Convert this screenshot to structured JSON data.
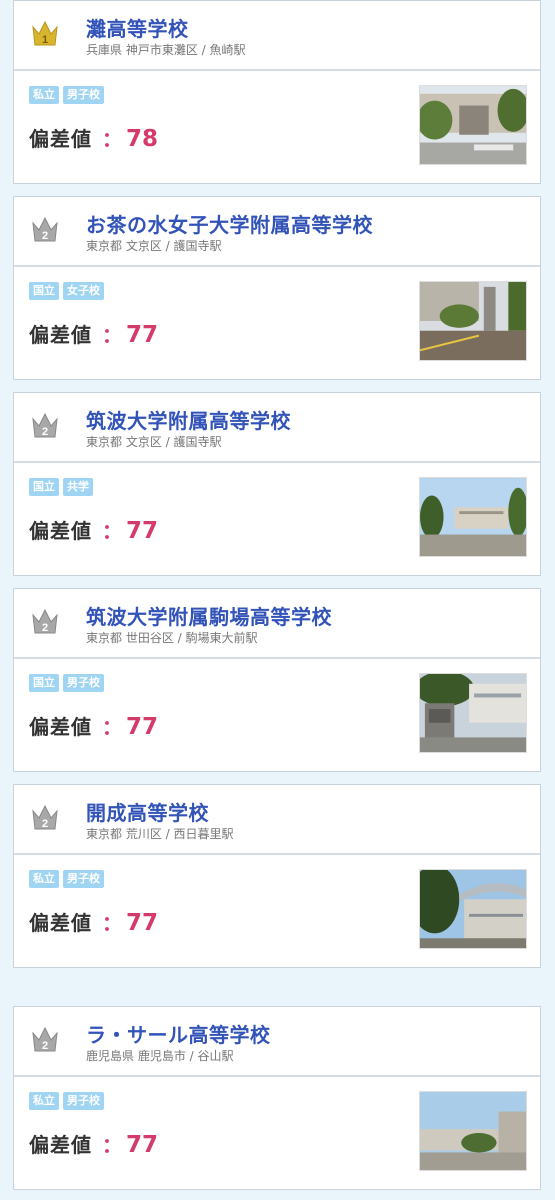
{
  "score_label": "偏差値",
  "score_colon": "：",
  "schools": [
    {
      "rank": "1",
      "name": "灘高等学校",
      "address": "兵庫県 神戸市東灘区 / 魚崎駅",
      "tags": [
        "私立",
        "男子校"
      ],
      "score": "78"
    },
    {
      "rank": "2",
      "name": "お茶の水女子大学附属高等学校",
      "address": "東京都 文京区 / 護国寺駅",
      "tags": [
        "国立",
        "女子校"
      ],
      "score": "77"
    },
    {
      "rank": "2",
      "name": "筑波大学附属高等学校",
      "address": "東京都 文京区 / 護国寺駅",
      "tags": [
        "国立",
        "共学"
      ],
      "score": "77"
    },
    {
      "rank": "2",
      "name": "筑波大学附属駒場高等学校",
      "address": "東京都 世田谷区 / 駒場東大前駅",
      "tags": [
        "国立",
        "男子校"
      ],
      "score": "77"
    },
    {
      "rank": "2",
      "name": "開成高等学校",
      "address": "東京都 荒川区 / 西日暮里駅",
      "tags": [
        "私立",
        "男子校"
      ],
      "score": "77"
    },
    {
      "rank": "2",
      "name": "ラ・サール高等学校",
      "address": "鹿児島県 鹿児島市 / 谷山駅",
      "tags": [
        "私立",
        "男子校"
      ],
      "score": "77"
    }
  ],
  "colors": {
    "name": "#3253b8",
    "score": "#d43a6a",
    "tag": "#9fd4f2",
    "crown_gold": "#d8b52c",
    "crown_gray": "#9a9a9a",
    "background": "#eaf4fb"
  }
}
